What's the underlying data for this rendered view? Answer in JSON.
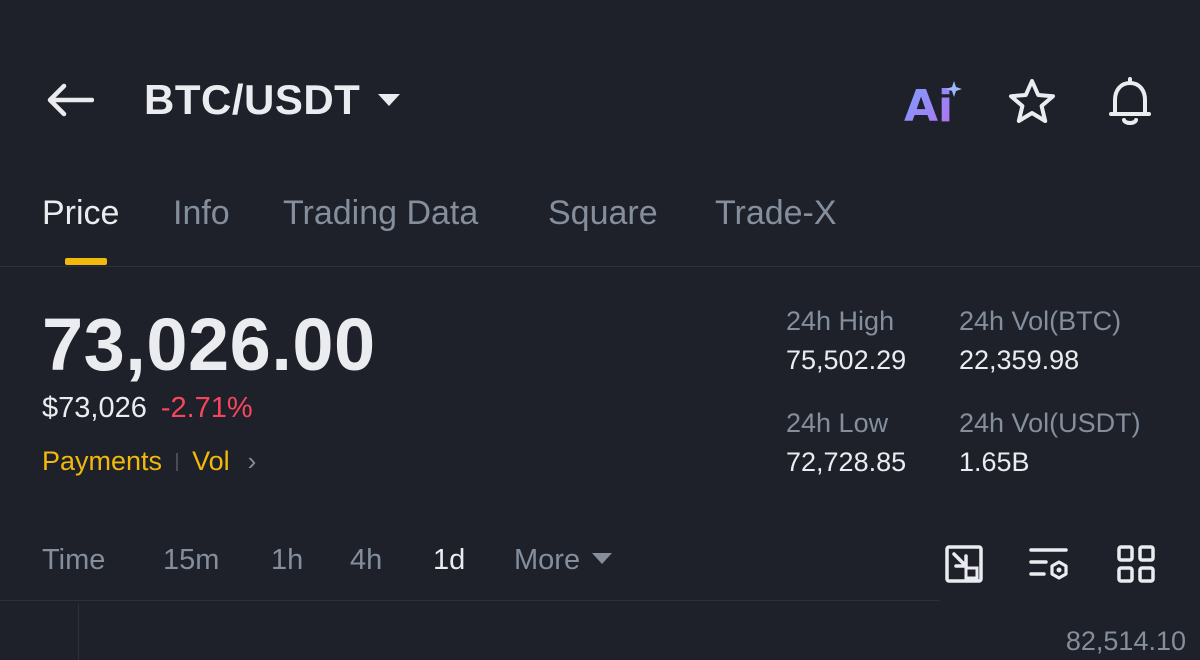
{
  "header": {
    "pair": "BTC/USDT",
    "icons": [
      "back-arrow-icon",
      "ai-icon",
      "star-icon",
      "bell-icon"
    ],
    "ai_label": "Ai"
  },
  "tabs": [
    {
      "label": "Price",
      "active": true
    },
    {
      "label": "Info",
      "active": false
    },
    {
      "label": "Trading Data",
      "active": false
    },
    {
      "label": "Square",
      "active": false
    },
    {
      "label": "Trade-X",
      "active": false
    }
  ],
  "price": {
    "last": "73,026.00",
    "usd": "$73,026",
    "change_pct": "-2.71%",
    "tags": [
      "Payments",
      "Vol"
    ]
  },
  "stats": {
    "high": {
      "label": "24h High",
      "value": "75,502.29"
    },
    "low": {
      "label": "24h Low",
      "value": "72,728.85"
    },
    "vol_base": {
      "label": "24h Vol(BTC)",
      "value": "22,359.98"
    },
    "vol_quote": {
      "label": "24h Vol(USDT)",
      "value": "1.65B"
    }
  },
  "intervals": [
    {
      "label": "Time",
      "active": false
    },
    {
      "label": "15m",
      "active": false
    },
    {
      "label": "1h",
      "active": false
    },
    {
      "label": "4h",
      "active": false
    },
    {
      "label": "1d",
      "active": true
    },
    {
      "label": "More",
      "active": false
    }
  ],
  "chart": {
    "top_price": "82,514.10"
  },
  "colors": {
    "background": "#1e2129",
    "accent": "#f0b90b",
    "negative": "#f6465d",
    "text_primary": "#eaecef",
    "text_secondary": "#848e9c"
  }
}
